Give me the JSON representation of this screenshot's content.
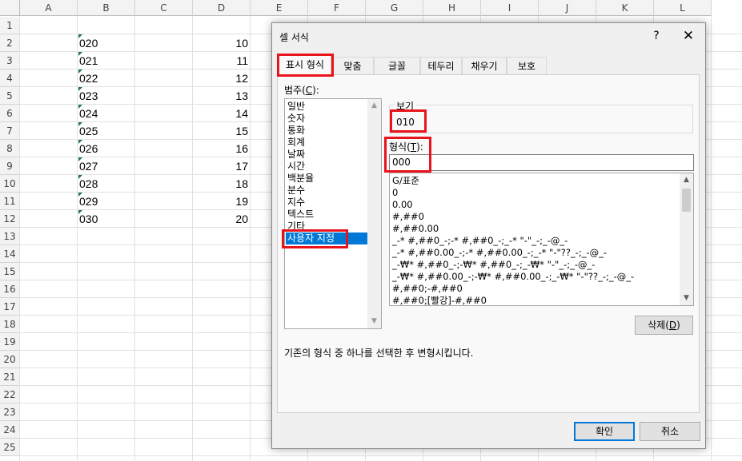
{
  "sheet": {
    "columns": [
      "A",
      "B",
      "C",
      "D",
      "E",
      "F",
      "G",
      "H",
      "I",
      "J",
      "K",
      "L"
    ],
    "rows": [
      "1",
      "2",
      "3",
      "4",
      "5",
      "6",
      "7",
      "8",
      "9",
      "10",
      "11",
      "12",
      "13",
      "14",
      "15",
      "16",
      "17",
      "18",
      "19",
      "20",
      "21",
      "22",
      "23",
      "24",
      "25"
    ],
    "col_b_values": [
      "020",
      "021",
      "022",
      "023",
      "024",
      "025",
      "026",
      "027",
      "028",
      "029",
      "030"
    ],
    "col_d_values": [
      "10",
      "11",
      "12",
      "13",
      "14",
      "15",
      "16",
      "17",
      "18",
      "19",
      "20"
    ]
  },
  "dialog": {
    "title": "셀 서식",
    "help": "?",
    "close": "✕",
    "tabs": [
      "표시 형식",
      "맞춤",
      "글꼴",
      "테두리",
      "채우기",
      "보호"
    ],
    "category_label": "범주(C):",
    "categories": [
      "일반",
      "숫자",
      "통화",
      "회계",
      "날짜",
      "시간",
      "백분율",
      "분수",
      "지수",
      "텍스트",
      "기타",
      "사용자 지정"
    ],
    "sample_label": "보기",
    "sample_value": "010",
    "type_label": "형식(T):",
    "type_value": "000",
    "formats": [
      "G/표준",
      "0",
      "0.00",
      "#,##0",
      "#,##0.00",
      "_-* #,##0_-;-* #,##0_-;_-* \"-\"_-;_-@_-",
      "_-* #,##0.00_-;-* #,##0.00_-;_-* \"-\"??_-;_-@_-",
      "_-₩* #,##0_-;-₩* #,##0_-;_-₩* \"-\"_-;_-@_-",
      "_-₩* #,##0.00_-;-₩* #,##0.00_-;_-₩* \"-\"??_-;_-@_-",
      "#,##0;-#,##0",
      "#,##0;[빨강]-#,##0"
    ],
    "delete_button": "삭제(D)",
    "description": "기존의 형식 중 하나를 선택한 후 변형시킵니다.",
    "ok_button": "확인",
    "cancel_button": "취소",
    "highlight_color": "#e8141b",
    "selection_color": "#0078d7"
  }
}
